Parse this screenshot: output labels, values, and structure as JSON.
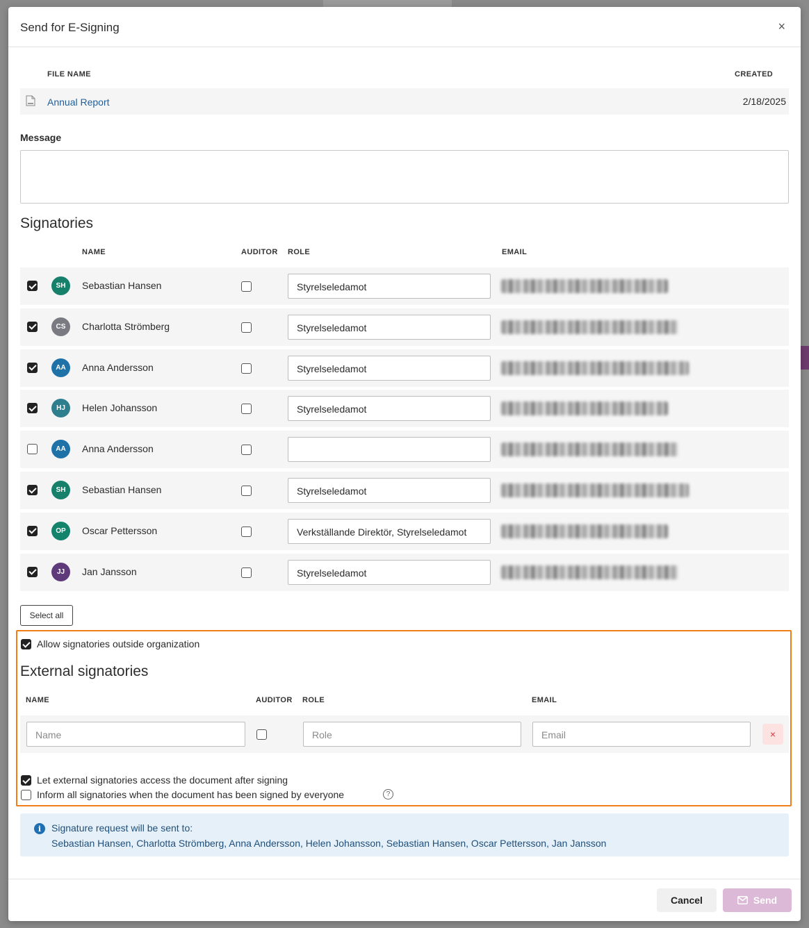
{
  "dialog": {
    "title": "Send for E-Signing",
    "close_label": "×"
  },
  "file_table": {
    "headers": {
      "file_name": "FILE NAME",
      "created": "CREATED"
    },
    "file": {
      "name": "Annual Report",
      "created": "2/18/2025",
      "icon": "pdf-file-icon"
    }
  },
  "message": {
    "label": "Message",
    "value": ""
  },
  "signatories": {
    "title": "Signatories",
    "headers": {
      "name": "NAME",
      "auditor": "AUDITOR",
      "role": "ROLE",
      "email": "EMAIL"
    },
    "rows": [
      {
        "checked": true,
        "initials": "SH",
        "avatar_color": "#16806a",
        "name": "Sebastian Hansen",
        "auditor": false,
        "role": "Styrelseledamot",
        "email_blurred": true
      },
      {
        "checked": true,
        "initials": "CS",
        "avatar_color": "#7a7a82",
        "name": "Charlotta Strömberg",
        "auditor": false,
        "role": "Styrelseledamot",
        "email_blurred": true
      },
      {
        "checked": true,
        "initials": "AA",
        "avatar_color": "#1f72a8",
        "name": "Anna Andersson",
        "auditor": false,
        "role": "Styrelseledamot",
        "email_blurred": true
      },
      {
        "checked": true,
        "initials": "HJ",
        "avatar_color": "#2f7e8e",
        "name": "Helen Johansson",
        "auditor": false,
        "role": "Styrelseledamot",
        "email_blurred": true
      },
      {
        "checked": false,
        "initials": "AA",
        "avatar_color": "#1f72a8",
        "name": "Anna Andersson",
        "auditor": false,
        "role": "",
        "email_blurred": true
      },
      {
        "checked": true,
        "initials": "SH",
        "avatar_color": "#16806a",
        "name": "Sebastian Hansen",
        "auditor": false,
        "role": "Styrelseledamot",
        "email_blurred": true
      },
      {
        "checked": true,
        "initials": "OP",
        "avatar_color": "#13836c",
        "name": "Oscar Pettersson",
        "auditor": false,
        "role": "Verkställande Direktör, Styrelseledamot",
        "email_blurred": true
      },
      {
        "checked": true,
        "initials": "JJ",
        "avatar_color": "#5e3a7a",
        "name": "Jan Jansson",
        "auditor": false,
        "role": "Styrelseledamot",
        "email_blurred": true
      }
    ],
    "select_all_label": "Select all"
  },
  "external": {
    "allow_outside_label": "Allow signatories outside organization",
    "allow_outside_checked": true,
    "title": "External signatories",
    "headers": {
      "name": "NAME",
      "auditor": "AUDITOR",
      "role": "ROLE",
      "email": "EMAIL"
    },
    "row": {
      "name_placeholder": "Name",
      "role_placeholder": "Role",
      "email_placeholder": "Email",
      "auditor": false,
      "delete_label": "×"
    },
    "access_after_label": "Let external signatories access the document after signing",
    "access_after_checked": true,
    "inform_all_label": "Inform all signatories when the document has been signed by everyone",
    "inform_all_checked": false,
    "help_icon": "?"
  },
  "info": {
    "icon": "i",
    "title": "Signature request will be sent to:",
    "recipients": "Sebastian Hansen, Charlotta Strömberg, Anna Andersson, Helen Johansson, Sebastian Hansen, Oscar Pettersson, Jan Jansson"
  },
  "footer": {
    "cancel_label": "Cancel",
    "send_label": "Send",
    "send_icon": "envelope-icon"
  },
  "colors": {
    "accent_highlight": "#f07c1a",
    "send_disabled": "#dcb9d6",
    "link": "#1f5f99"
  }
}
